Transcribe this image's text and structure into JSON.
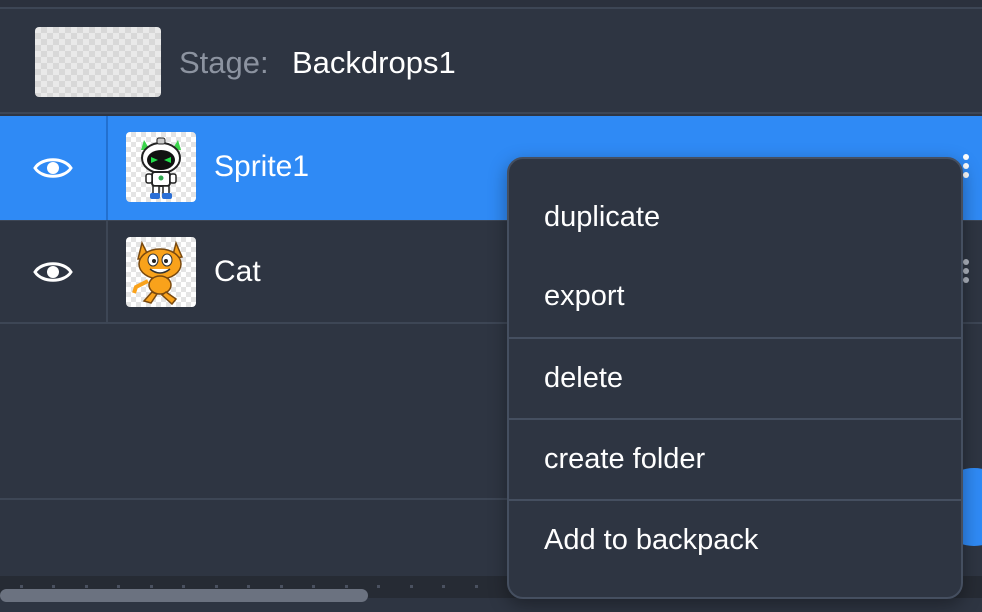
{
  "stage": {
    "label": "Stage:",
    "backdrop_name": "Backdrops1"
  },
  "sprites": [
    {
      "name": "Sprite1",
      "selected": true,
      "visible": true,
      "thumbnail": "robot-sprite"
    },
    {
      "name": "Cat",
      "selected": false,
      "visible": true,
      "thumbnail": "cat-sprite"
    }
  ],
  "context_menu": {
    "items": [
      "duplicate",
      "export",
      "delete",
      "create folder",
      "Add to backpack"
    ]
  },
  "icons": {
    "visibility": "eye-icon",
    "more": "vertical-dots-icon"
  },
  "colors": {
    "accent": "#2f8af5",
    "panel": "#2e3542",
    "border": "#3d4655",
    "muted_text": "#8c93a0"
  }
}
